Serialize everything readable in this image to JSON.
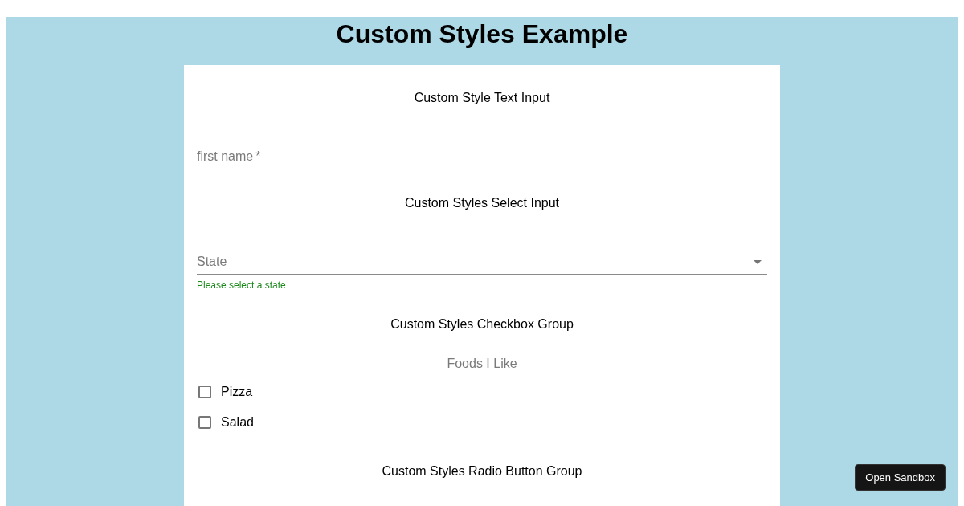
{
  "title": "Custom Styles Example",
  "sections": [
    {
      "kind": "text",
      "heading": "Custom Style Text Input",
      "label": "first name",
      "required_mark": "*"
    },
    {
      "kind": "select",
      "heading": "Custom Styles Select Input",
      "label": "State",
      "helper": "Please select a state"
    },
    {
      "kind": "checkbox",
      "heading": "Custom Styles Checkbox Group",
      "legend": "Foods I Like",
      "options": [
        {
          "label": "Pizza",
          "checked": false
        },
        {
          "label": "Salad",
          "checked": false
        }
      ]
    },
    {
      "kind": "radio",
      "heading": "Custom Styles Radio Button Group"
    }
  ],
  "sandbox_button": "Open Sandbox"
}
